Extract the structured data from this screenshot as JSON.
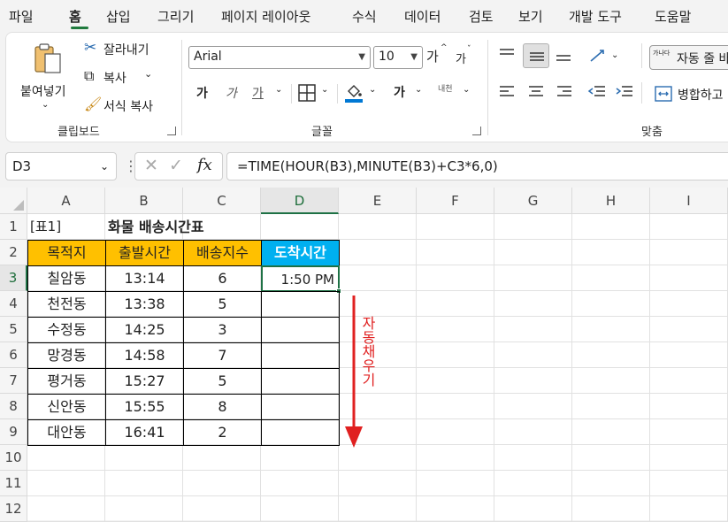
{
  "menu": {
    "tabs": [
      "파일",
      "홈",
      "삽입",
      "그리기",
      "페이지 레이아웃",
      "수식",
      "데이터",
      "검토",
      "보기",
      "개발 도구",
      "도움말"
    ],
    "active_tab": "홈"
  },
  "ribbon": {
    "clipboard": {
      "paste": "붙여넣기",
      "cut": "잘라내기",
      "copy": "복사",
      "format_painter": "서식 복사",
      "label": "클립보드"
    },
    "font": {
      "font_name": "Arial",
      "font_size": "10",
      "grow": "가",
      "shrink": "가",
      "bold": "가",
      "italic": "가",
      "underline": "가",
      "fill_color": "#ffff00",
      "font_color": "#000000",
      "fill_bar_color": "#0078d4",
      "bold_b": "가",
      "phonetic": "내천",
      "label": "글꼴"
    },
    "alignment": {
      "wrap_text": "자동 줄 바",
      "wrap_icon_text": "가나다",
      "merge": "병합하고",
      "label": "맞춤"
    }
  },
  "formula_bar": {
    "name_box": "D3",
    "fx": "fx",
    "formula": "=TIME(HOUR(B3),MINUTE(B3)+C3*6,0)"
  },
  "sheet": {
    "columns": [
      "A",
      "B",
      "C",
      "D",
      "E",
      "F",
      "G",
      "H",
      "I"
    ],
    "rows": [
      "1",
      "2",
      "3",
      "4",
      "5",
      "6",
      "7",
      "8",
      "9",
      "10",
      "11",
      "12"
    ],
    "title_tag": "[표1]",
    "title": "화물 배송시간표",
    "headers": [
      "목적지",
      "출발시간",
      "배송지수",
      "도착시간"
    ],
    "header_color": "#ffc000",
    "header_d_color": "#00b0f0",
    "data": [
      [
        "칠암동",
        "13:14",
        "6",
        "1:50 PM"
      ],
      [
        "천전동",
        "13:38",
        "5",
        ""
      ],
      [
        "수정동",
        "14:25",
        "3",
        ""
      ],
      [
        "망경동",
        "14:58",
        "7",
        ""
      ],
      [
        "평거동",
        "15:27",
        "5",
        ""
      ],
      [
        "신안동",
        "15:55",
        "8",
        ""
      ],
      [
        "대안동",
        "16:41",
        "2",
        ""
      ]
    ],
    "annotation": "자동채우기",
    "annotation_color": "#e02020"
  }
}
